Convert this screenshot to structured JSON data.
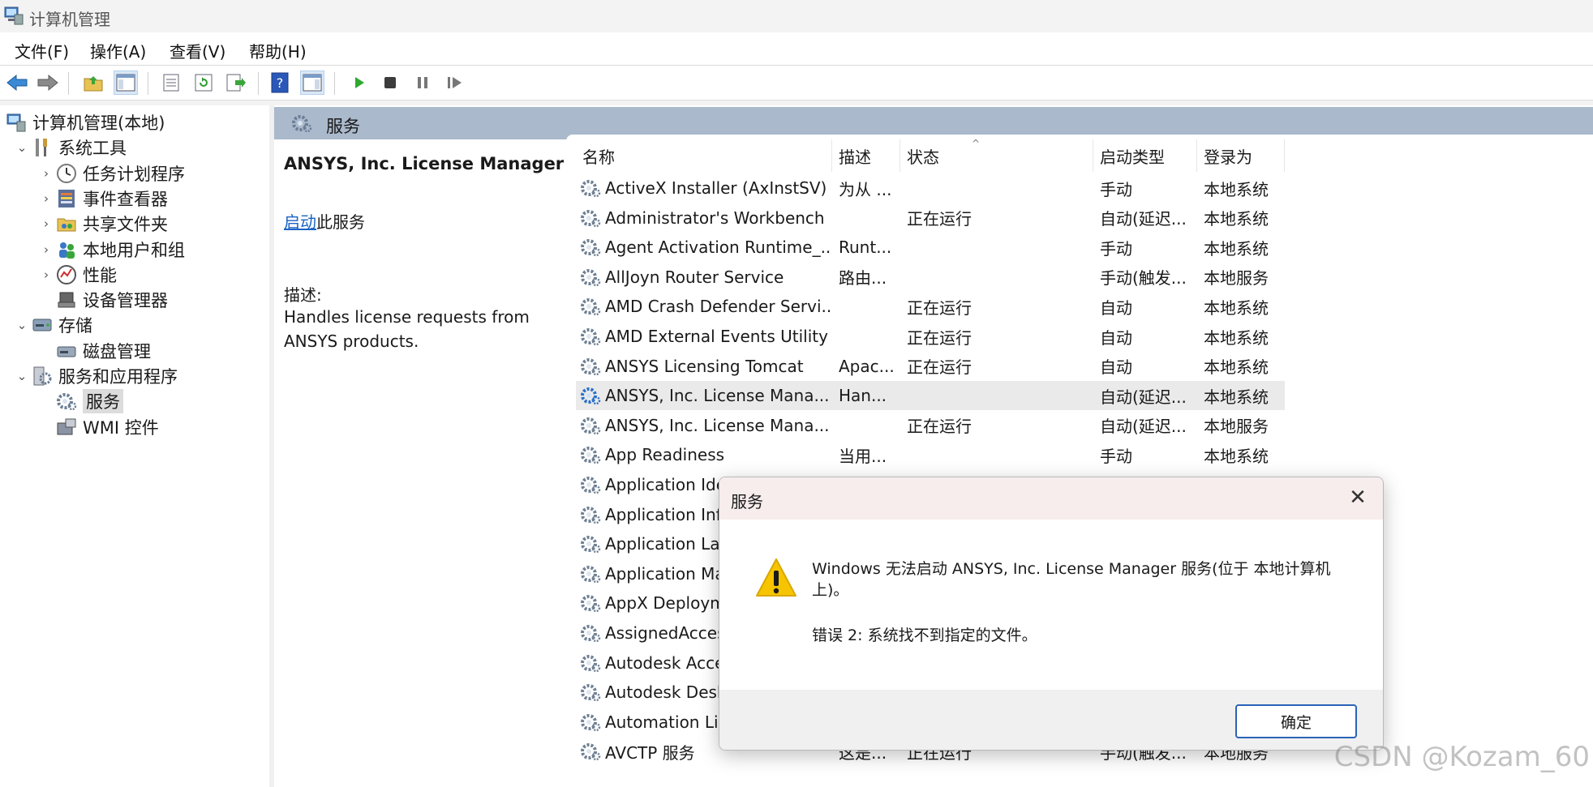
{
  "window": {
    "title": "计算机管理"
  },
  "menu": [
    "文件(F)",
    "操作(A)",
    "查看(V)",
    "帮助(H)"
  ],
  "tree": [
    {
      "label": "计算机管理(本地)",
      "chevron": "",
      "icon": "computer-management-icon",
      "level": 0
    },
    {
      "label": "系统工具",
      "chevron": "⌄",
      "icon": "system-tools-icon",
      "level": 1
    },
    {
      "label": "任务计划程序",
      "chevron": "›",
      "icon": "clock-icon",
      "level": 2
    },
    {
      "label": "事件查看器",
      "chevron": "›",
      "icon": "event-viewer-icon",
      "level": 2
    },
    {
      "label": "共享文件夹",
      "chevron": "›",
      "icon": "shared-folder-icon",
      "level": 2
    },
    {
      "label": "本地用户和组",
      "chevron": "›",
      "icon": "users-icon",
      "level": 2
    },
    {
      "label": "性能",
      "chevron": "›",
      "icon": "performance-icon",
      "level": 2
    },
    {
      "label": "设备管理器",
      "chevron": "",
      "icon": "device-manager-icon",
      "level": 2
    },
    {
      "label": "存储",
      "chevron": "⌄",
      "icon": "storage-icon",
      "level": 1
    },
    {
      "label": "磁盘管理",
      "chevron": "",
      "icon": "disk-icon",
      "level": 2
    },
    {
      "label": "服务和应用程序",
      "chevron": "⌄",
      "icon": "services-apps-icon",
      "level": 1
    },
    {
      "label": "服务",
      "chevron": "",
      "icon": "gear-icon",
      "level": 2,
      "selected": true
    },
    {
      "label": "WMI 控件",
      "chevron": "",
      "icon": "wmi-icon",
      "level": 2
    }
  ],
  "panel": {
    "header": "服务",
    "service_title": "ANSYS, Inc. License Manager",
    "start_link": "启动",
    "start_suffix": "此服务",
    "desc_label": "描述:",
    "desc_text": "Handles license requests from ANSYS products."
  },
  "columns": [
    "名称",
    "描述",
    "状态",
    "启动类型",
    "登录为"
  ],
  "services": [
    {
      "name": "ActiveX Installer (AxInstSV)",
      "desc": "为从 ...",
      "status": "",
      "startup": "手动",
      "logon": "本地系统"
    },
    {
      "name": "Administrator's Workbench",
      "desc": "",
      "status": "正在运行",
      "startup": "自动(延迟...",
      "logon": "本地系统"
    },
    {
      "name": "Agent Activation Runtime_...",
      "desc": "Runt...",
      "status": "",
      "startup": "手动",
      "logon": "本地系统"
    },
    {
      "name": "AllJoyn Router Service",
      "desc": "路由...",
      "status": "",
      "startup": "手动(触发...",
      "logon": "本地服务"
    },
    {
      "name": "AMD Crash Defender Servi...",
      "desc": "",
      "status": "正在运行",
      "startup": "自动",
      "logon": "本地系统"
    },
    {
      "name": "AMD External Events Utility",
      "desc": "",
      "status": "正在运行",
      "startup": "自动",
      "logon": "本地系统"
    },
    {
      "name": "ANSYS Licensing Tomcat",
      "desc": "Apac...",
      "status": "正在运行",
      "startup": "自动",
      "logon": "本地系统"
    },
    {
      "name": "ANSYS, Inc. License Mana...",
      "desc": "Han...",
      "status": "",
      "startup": "自动(延迟...",
      "logon": "本地系统",
      "highlight": true
    },
    {
      "name": "ANSYS, Inc. License Mana...",
      "desc": "",
      "status": "正在运行",
      "startup": "自动(延迟...",
      "logon": "本地服务"
    },
    {
      "name": "App Readiness",
      "desc": "当用...",
      "status": "",
      "startup": "手动",
      "logon": "本地系统"
    },
    {
      "name": "Application Ide",
      "desc": "",
      "status": "",
      "startup": "",
      "logon": ""
    },
    {
      "name": "Application Inf",
      "desc": "",
      "status": "",
      "startup": "",
      "logon": ""
    },
    {
      "name": "Application Lay",
      "desc": "",
      "status": "",
      "startup": "",
      "logon": ""
    },
    {
      "name": "Application Ma",
      "desc": "",
      "status": "",
      "startup": "",
      "logon": ""
    },
    {
      "name": "AppX Deploym",
      "desc": "",
      "status": "",
      "startup": "",
      "logon": ""
    },
    {
      "name": "AssignedAcces",
      "desc": "",
      "status": "",
      "startup": "",
      "logon": ""
    },
    {
      "name": "Autodesk Acce",
      "desc": "",
      "status": "",
      "startup": "",
      "logon": ""
    },
    {
      "name": "Autodesk Desk",
      "desc": "",
      "status": "",
      "startup": "",
      "logon": ""
    },
    {
      "name": "Automation Lic",
      "desc": "",
      "status": "",
      "startup": "",
      "logon": ""
    },
    {
      "name": "AVCTP 服务",
      "desc": "这是...",
      "status": "正在运行",
      "startup": "手动(触发...",
      "logon": "本地服务"
    }
  ],
  "dialog": {
    "title": "服务",
    "message": "Windows 无法启动 ANSYS, Inc. License Manager 服务(位于 本地计算机 上)。",
    "error": "错误 2: 系统找不到指定的文件。",
    "ok_label": "确定",
    "close_glyph": "✕"
  },
  "watermark": "CSDN @Kozam_60"
}
